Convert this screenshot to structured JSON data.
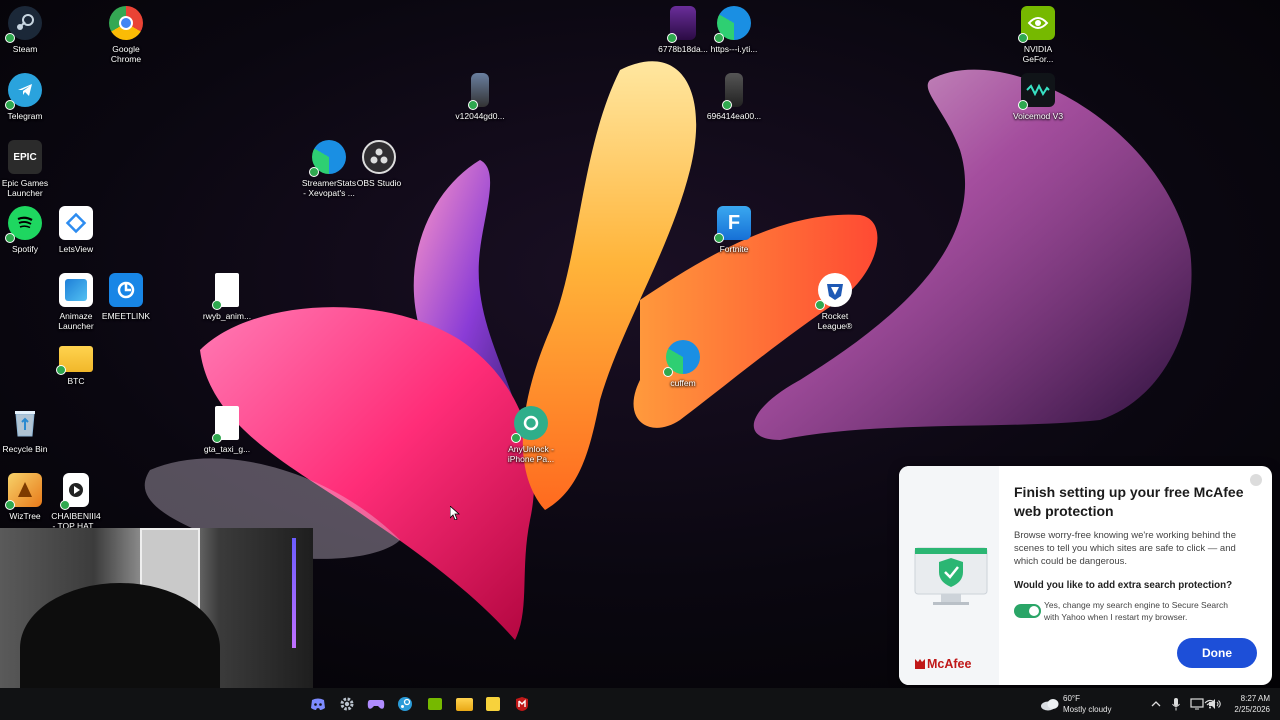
{
  "desktop": {
    "icons": [
      {
        "label": "Steam",
        "icon": "steam-icon"
      },
      {
        "label": "Google\nChrome",
        "icon": "chrome-icon"
      },
      {
        "label": "Telegram",
        "icon": "telegram-icon"
      },
      {
        "label": "Epic Games\nLauncher",
        "icon": "epic-games-icon",
        "glyph": "EPIC"
      },
      {
        "label": "Spotify",
        "icon": "spotify-icon"
      },
      {
        "label": "LetsView",
        "icon": "letsview-icon"
      },
      {
        "label": "Animaze\nLauncher",
        "icon": "animaze-icon"
      },
      {
        "label": "EMEETLINK",
        "icon": "emeetlink-icon"
      },
      {
        "label": "BTC",
        "icon": "folder-icon"
      },
      {
        "label": "Recycle Bin",
        "icon": "recycle-bin-icon"
      },
      {
        "label": "WizTree",
        "icon": "wiztree-icon"
      },
      {
        "label": "CHAIBENIII4\n- TOP HAT...",
        "icon": "video-file-icon"
      },
      {
        "label": "rwyb_anim...",
        "icon": "file-icon"
      },
      {
        "label": "gta_taxi_g...",
        "icon": "file-icon"
      },
      {
        "label": "StreamerStats\n- Xevopat's ...",
        "icon": "edge-icon"
      },
      {
        "label": "OBS Studio",
        "icon": "obs-icon"
      },
      {
        "label": "v12044gd0...",
        "icon": "image-file-icon"
      },
      {
        "label": "6778b18da...",
        "icon": "image-file-icon"
      },
      {
        "label": "https---i.yti...",
        "icon": "edge-icon"
      },
      {
        "label": "696414ea00...",
        "icon": "image-file-icon"
      },
      {
        "label": "Fortnite",
        "icon": "fortnite-icon",
        "glyph": "F"
      },
      {
        "label": "Rocket\nLeague®",
        "icon": "rocket-league-icon"
      },
      {
        "label": "cuffem",
        "icon": "edge-icon"
      },
      {
        "label": "AnyUnlock -\niPhone Pa...",
        "icon": "anyunlock-icon"
      },
      {
        "label": "NVIDIA\nGeFor...",
        "icon": "nvidia-icon"
      },
      {
        "label": "Voicemod V3",
        "icon": "voicemod-icon"
      }
    ]
  },
  "mcafee": {
    "title": "Finish setting up your free McAfee web protection",
    "body": "Browse worry-free knowing we're working behind the scenes to tell you which sites are safe to click — and which could be dangerous.",
    "question": "Would you like to add extra search protection?",
    "toggle_label": "Yes, change my search engine to Secure Search with Yahoo when I restart my browser.",
    "toggle_on": true,
    "brand": "McAfee",
    "done_label": "Done",
    "colors": {
      "accent": "#1d4fd8",
      "toggle": "#2aa567",
      "brand": "#c01818"
    }
  },
  "taskbar": {
    "apps": [
      "discord-icon",
      "settings-icon",
      "xbox-icon",
      "steam-icon",
      "nvidia-icon",
      "file-explorer-icon",
      "sticky-notes-icon",
      "mcafee-icon"
    ],
    "weather": {
      "temp": "60°F",
      "condition": "Mostly cloudy"
    },
    "clock": {
      "time": "8:27 AM",
      "date": "2/25/2026"
    }
  }
}
